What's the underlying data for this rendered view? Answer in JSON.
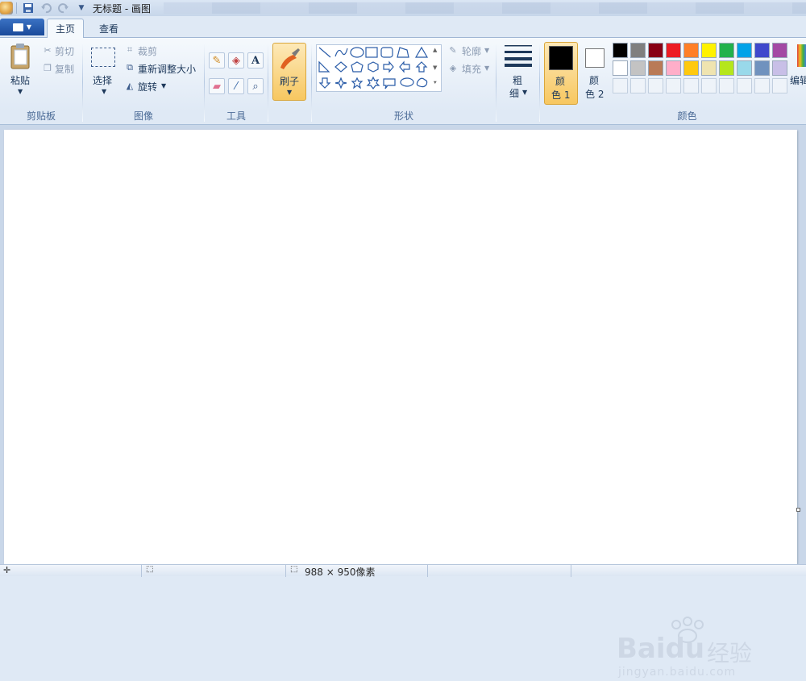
{
  "titlebar": {
    "window_title": "无标题 - 画图"
  },
  "tabs": {
    "file_icon": "menu-doc-icon",
    "home": "主页",
    "view": "查看"
  },
  "clipboard": {
    "paste": "粘贴",
    "cut": "剪切",
    "copy": "复制",
    "group": "剪贴板"
  },
  "image": {
    "select": "选择",
    "crop": "裁剪",
    "resize": "重新调整大小",
    "rotate": "旋转",
    "group": "图像"
  },
  "tools": {
    "group": "工具",
    "text_glyph": "A"
  },
  "brushes": {
    "label": "刷子"
  },
  "shapes": {
    "outline": "轮廓",
    "fill": "填充",
    "group": "形状"
  },
  "size": {
    "label_line1": "粗",
    "label_line2": "细"
  },
  "colors": {
    "color1_line1": "颜",
    "color1_line2": "色 1",
    "color2_line1": "颜",
    "color2_line2": "色 2",
    "edit": "编辑",
    "group": "颜色",
    "color1_value": "#000000",
    "color2_value": "#ffffff",
    "palette_row1": [
      "#000000",
      "#7f7f7f",
      "#880015",
      "#ed1c24",
      "#ff7f27",
      "#fff200",
      "#22b14c",
      "#00a2e8",
      "#3f48cc",
      "#a349a4"
    ],
    "palette_row2": [
      "#ffffff",
      "#c3c3c3",
      "#b97a57",
      "#ffaec9",
      "#ffc90e",
      "#efe4b0",
      "#b5e61d",
      "#99d9ea",
      "#7092be",
      "#c8bfe7"
    ],
    "palette_row3": [
      "#eef3f9",
      "#eef3f9",
      "#eef3f9",
      "#eef3f9",
      "#eef3f9",
      "#eef3f9",
      "#eef3f9",
      "#eef3f9",
      "#eef3f9",
      "#eef3f9"
    ]
  },
  "status": {
    "canvas_size": "988 × 950像素"
  },
  "watermark": {
    "brand": "Bai",
    "brand2": "du",
    "cn": "经验",
    "url": "jingyan.baidu.com"
  }
}
